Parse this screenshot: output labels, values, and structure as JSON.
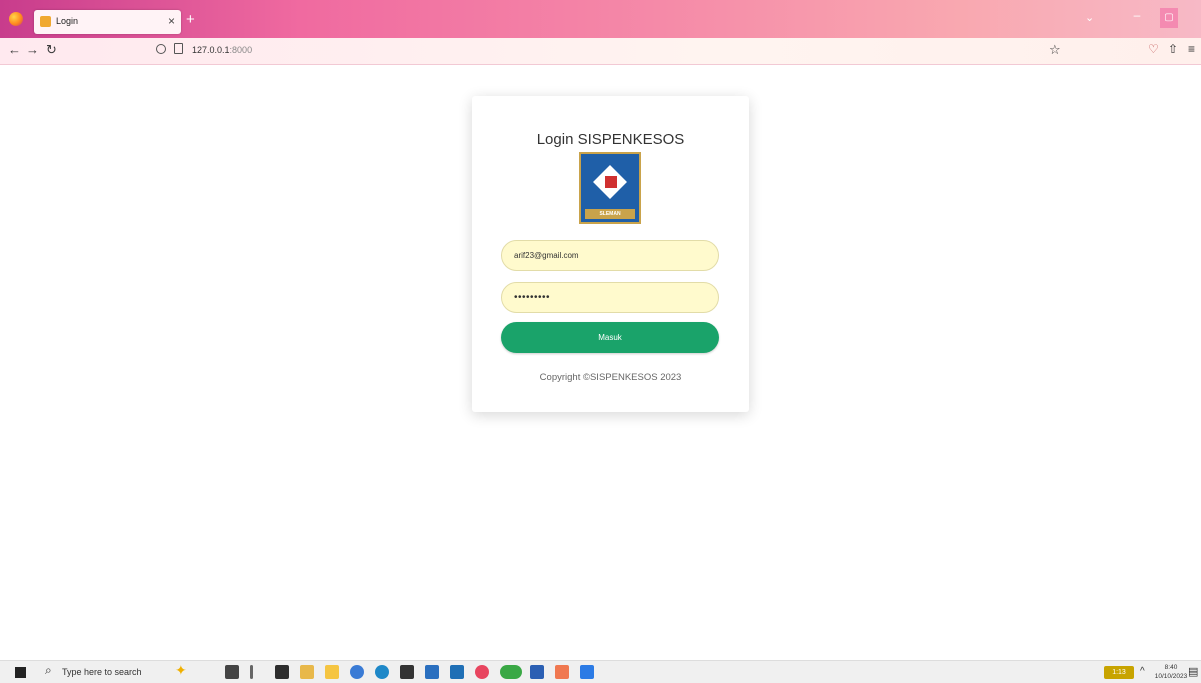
{
  "browser": {
    "tab_title": "Login",
    "tab_close": "×",
    "new_tab": "+",
    "list_tabs": "⌄",
    "minimize": "–",
    "maximize": "▢",
    "nav_back": "←",
    "nav_forward": "→",
    "nav_reload": "↻",
    "url_host": "127.0.0.1",
    "url_port": ":8000",
    "bookmark": "☆",
    "toolbar_pocket": "♡",
    "toolbar_extensions": "⇧",
    "toolbar_menu": "≡"
  },
  "login": {
    "title": "Login SISPENKESOS",
    "logo_text": "SLEMAN",
    "email_value": "arif23@gmail.com",
    "password_value": "•••••••••",
    "submit_label": "Masuk",
    "copyright": "Copyright ©SISPENKESOS 2023"
  },
  "taskbar": {
    "search_placeholder": "Type here to search",
    "battery_label": "1:13",
    "clock_time": "8:40",
    "clock_date": "10/10/2023",
    "tray_chevron": "^",
    "tray_network": "⊕",
    "tray_volume": "🔈",
    "tray_pen": "✎",
    "tray_keyboard": "⌨",
    "notifications": "▤"
  },
  "colors": {
    "accent_green": "#1aa36a",
    "field_fill": "#fffacd"
  }
}
